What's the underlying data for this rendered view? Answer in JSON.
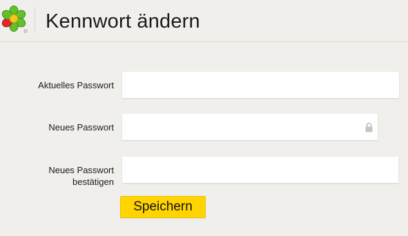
{
  "header": {
    "logo_icon": "icq-flower-logo-icon",
    "title": "Kennwort ändern"
  },
  "form": {
    "current_password": {
      "label": "Aktuelles Passwort",
      "value": ""
    },
    "new_password": {
      "label": "Neues Passwort",
      "value": "",
      "icon": "lock-icon"
    },
    "confirm_password": {
      "label_line1": "Neues Passwort",
      "label_line2": "bestätigen",
      "value": ""
    },
    "save_label": "Speichern"
  },
  "colors": {
    "background": "#f0efeb",
    "button": "#ffd400",
    "logo_green": "#5dbb25",
    "logo_red": "#e2272b"
  }
}
